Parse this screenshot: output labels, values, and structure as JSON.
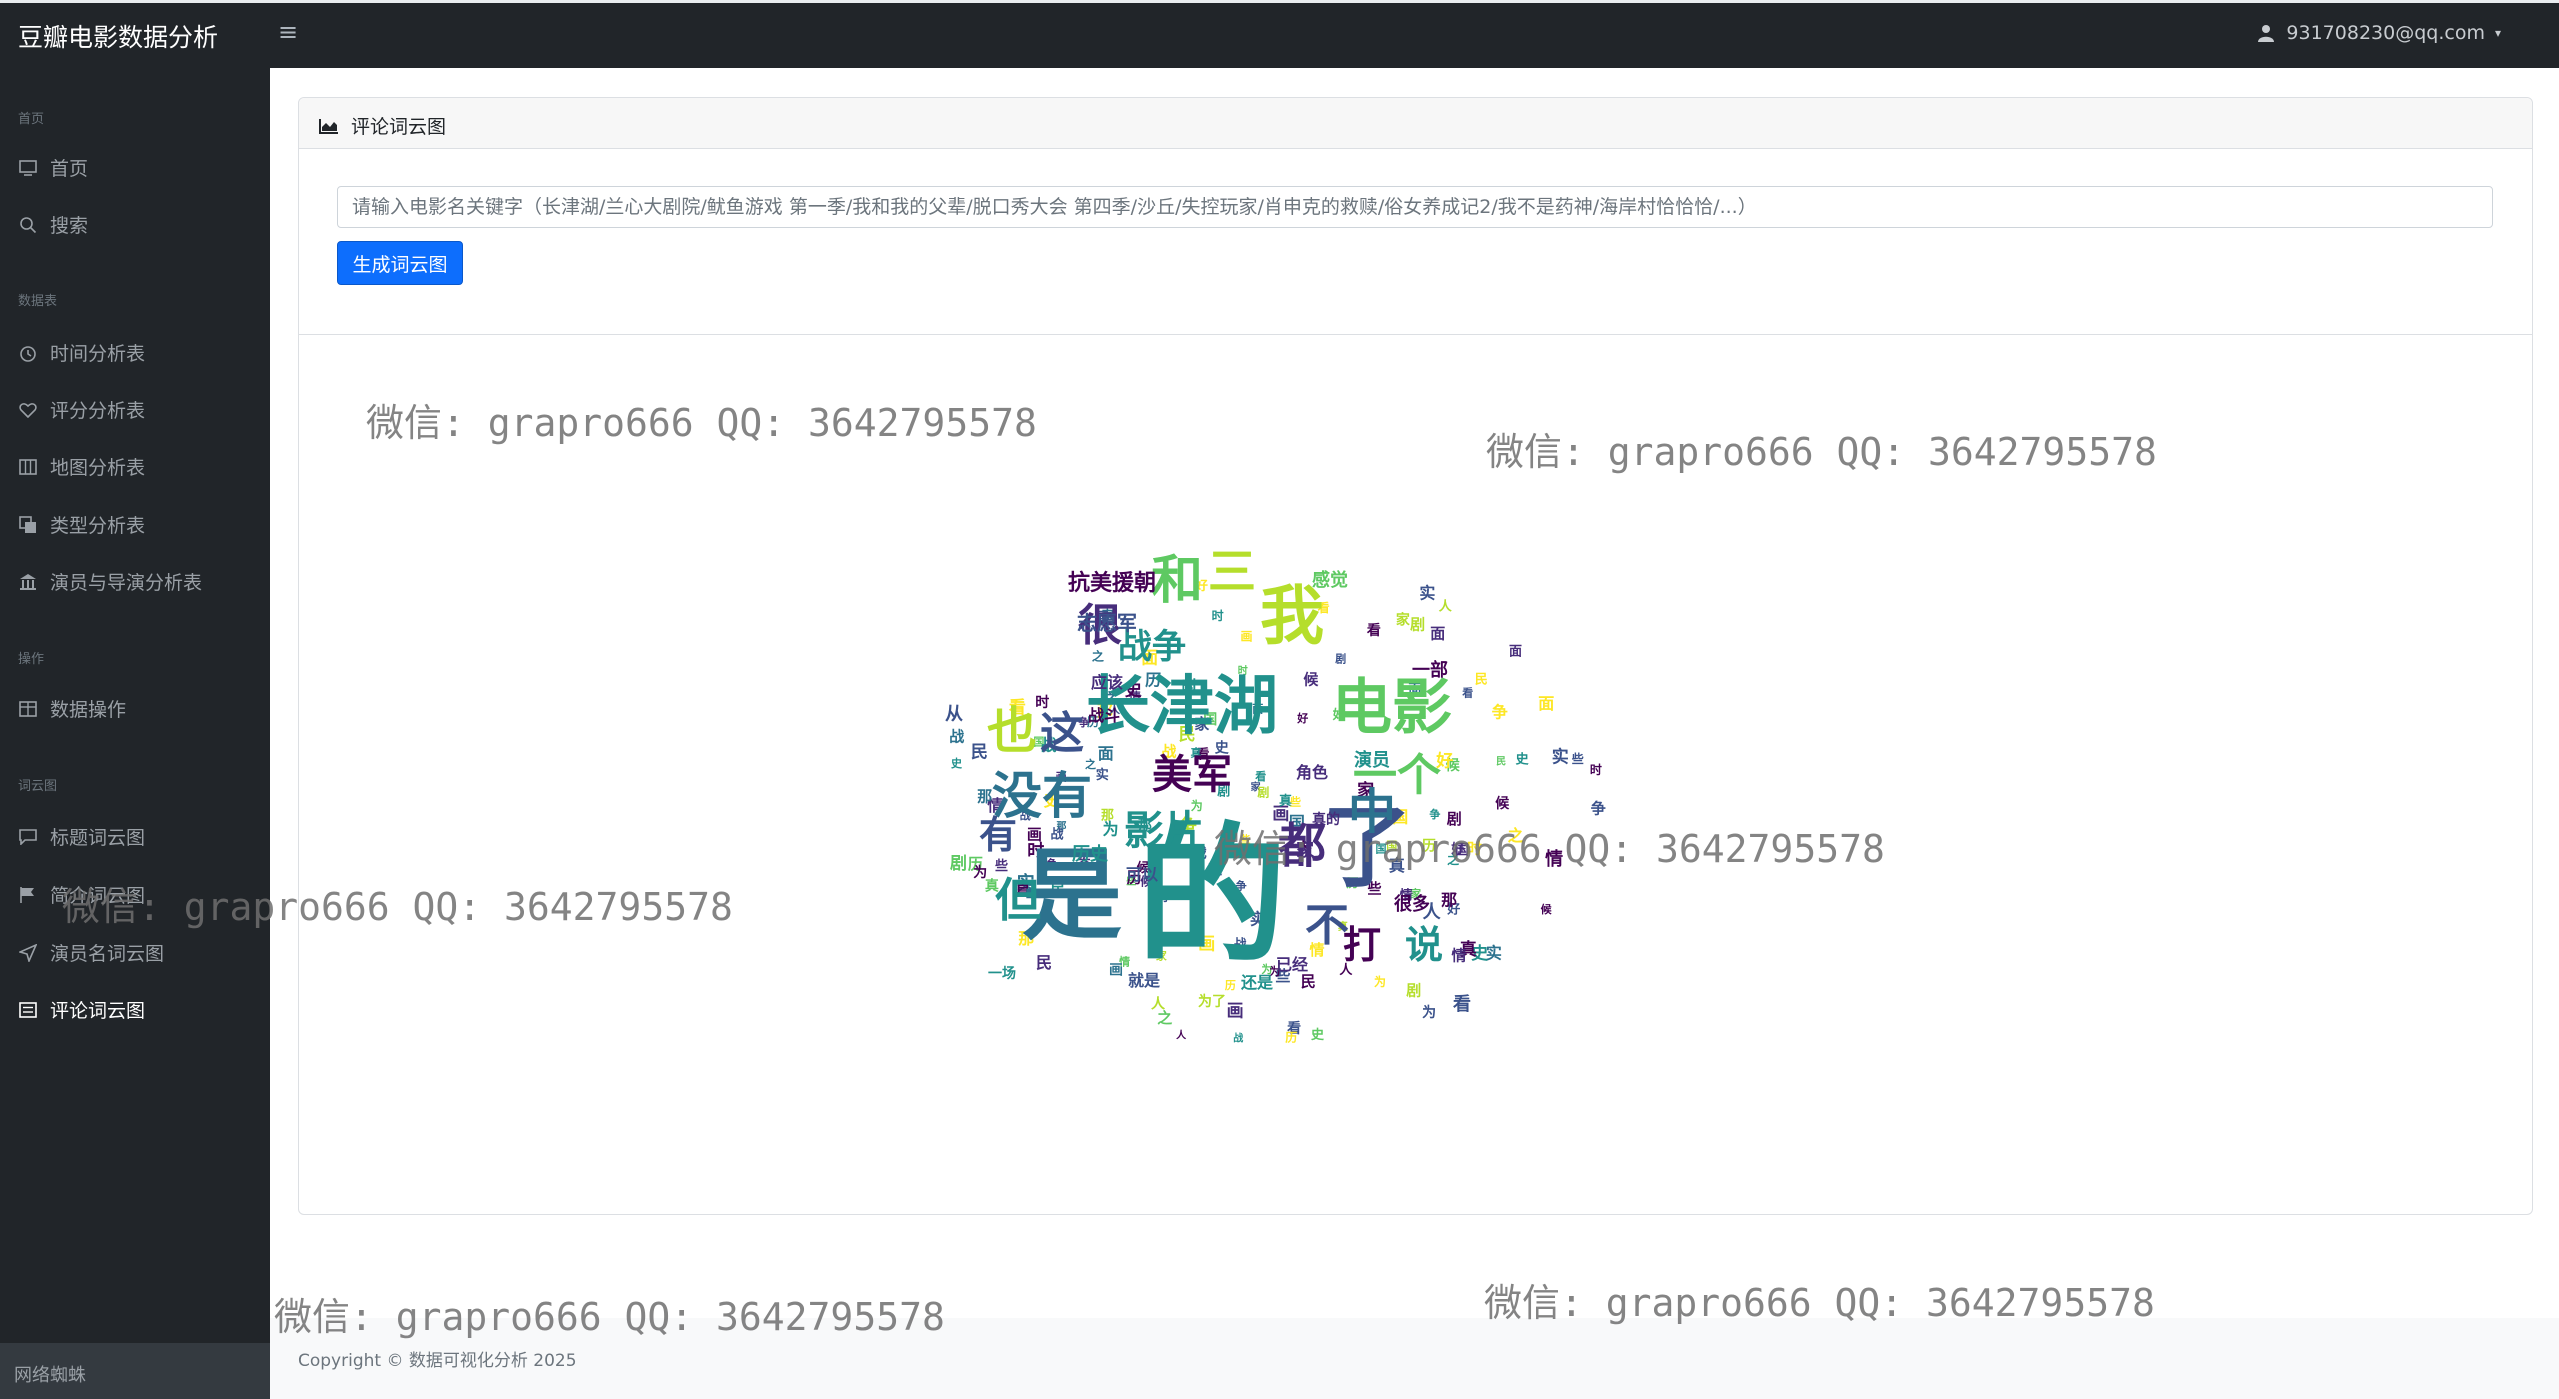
{
  "navbar": {
    "brand": "豆瓣电影数据分析",
    "toggle_glyph": "≡",
    "user_email": "931708230@qq.com",
    "caret_glyph": "▾"
  },
  "sidebar": {
    "headings": [
      "首页",
      "数据表",
      "操作",
      "词云图"
    ],
    "items": [
      {
        "label": "首页",
        "icon": "monitor-icon"
      },
      {
        "label": "搜索",
        "icon": "search-icon"
      },
      {
        "label": "时间分析表",
        "icon": "clock-icon"
      },
      {
        "label": "评分分析表",
        "icon": "heart-icon"
      },
      {
        "label": "地图分析表",
        "icon": "map-icon"
      },
      {
        "label": "类型分析表",
        "icon": "layers-icon"
      },
      {
        "label": "演员与导演分析表",
        "icon": "bank-icon"
      },
      {
        "label": "数据操作",
        "icon": "table-icon"
      },
      {
        "label": "标题词云图",
        "icon": "chat-icon"
      },
      {
        "label": "简介词云图",
        "icon": "flag-icon"
      },
      {
        "label": "演员名词云图",
        "icon": "send-icon"
      },
      {
        "label": "评论词云图",
        "icon": "list-icon"
      }
    ],
    "active_item": "评论词云图",
    "footer": "网络蜘蛛"
  },
  "card": {
    "title": "评论词云图",
    "title_icon": "area-chart-icon",
    "input_placeholder": "请输入电影名关键字（长津湖/兰心大剧院/鱿鱼游戏 第一季/我和我的父辈/脱口秀大会 第四季/沙丘/失控玩家/肖申克的救赎/俗女养成记2/我不是药神/海岸村恰恰恰/...）",
    "input_value": "",
    "generate_button": "生成词云图"
  },
  "wordcloud": {
    "palette": [
      "#440154",
      "#3b528b",
      "#21918c",
      "#5ec962",
      "#b5de2b",
      "#fde725",
      "#2c728e",
      "#472d7b"
    ],
    "words": [
      {
        "t": "的",
        "c": "#21918c"
      },
      {
        "t": "是",
        "c": "#2c728e"
      },
      {
        "t": "了",
        "c": "#3b528b"
      },
      {
        "t": "长津湖",
        "c": "#21918c"
      },
      {
        "t": "电影",
        "c": "#5ec962"
      },
      {
        "t": "我",
        "c": "#b5de2b"
      },
      {
        "t": "和",
        "c": "#5ec962"
      },
      {
        "t": "三",
        "c": "#b5de2b"
      },
      {
        "t": "也",
        "c": "#b5de2b"
      },
      {
        "t": "这",
        "c": "#3b528b"
      },
      {
        "t": "没有",
        "c": "#2c728e"
      },
      {
        "t": "很",
        "c": "#472d7b"
      },
      {
        "t": "战争",
        "c": "#21918c"
      },
      {
        "t": "美军",
        "c": "#440154"
      },
      {
        "t": "影片",
        "c": "#21918c"
      },
      {
        "t": "都",
        "c": "#472d7b"
      },
      {
        "t": "中",
        "c": "#2c728e"
      },
      {
        "t": "不",
        "c": "#3b528b"
      },
      {
        "t": "打",
        "c": "#440154"
      },
      {
        "t": "说",
        "c": "#21918c"
      },
      {
        "t": "一个",
        "c": "#5ec962"
      },
      {
        "t": "但",
        "c": "#21918c"
      },
      {
        "t": "有",
        "c": "#3b528b"
      },
      {
        "t": "抗美援朝",
        "c": "#440154"
      },
      {
        "t": "志愿军",
        "c": "#3b528b"
      },
      {
        "t": "应该",
        "c": "#472d7b"
      },
      {
        "t": "历史",
        "c": "#21918c"
      },
      {
        "t": "就是",
        "c": "#3b528b"
      },
      {
        "t": "还是",
        "c": "#21918c"
      },
      {
        "t": "已经",
        "c": "#472d7b"
      },
      {
        "t": "感觉",
        "c": "#5ec962"
      },
      {
        "t": "战斗",
        "c": "#440154"
      },
      {
        "t": "从",
        "c": "#3b528b"
      },
      {
        "t": "为了",
        "c": "#b5de2b"
      },
      {
        "t": "演员",
        "c": "#21918c"
      },
      {
        "t": "角色",
        "c": "#472d7b"
      },
      {
        "t": "可以",
        "c": "#3b528b"
      },
      {
        "t": "一场",
        "c": "#21918c"
      },
      {
        "t": "很多",
        "c": "#440154"
      },
      {
        "t": "看",
        "c": "#3b528b"
      },
      {
        "t": "一部",
        "c": "#440154"
      },
      {
        "t": "真的",
        "c": "#472d7b"
      }
    ]
  },
  "footer": {
    "copyright": "Copyright © 数据可视化分析 2025"
  },
  "watermarks": [
    "微信: grapro666 QQ: 3642795578",
    "微信: grapro666 QQ: 3642795578",
    "微信: grapro666 QQ: 3642795578",
    "微信: grapro666 QQ: 3642795578",
    "微信: grapro666 QQ: 3642795578",
    "微信: grapro666 QQ: 3642795578"
  ]
}
